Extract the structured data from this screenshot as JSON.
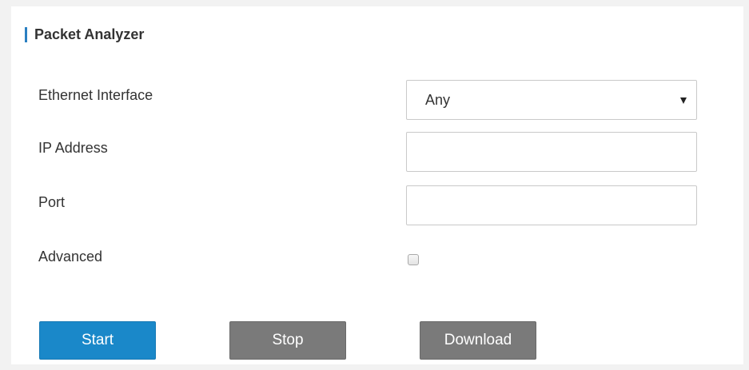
{
  "section": {
    "title": "Packet Analyzer"
  },
  "form": {
    "ethernet_interface": {
      "label": "Ethernet Interface",
      "selected": "Any"
    },
    "ip_address": {
      "label": "IP Address",
      "value": ""
    },
    "port": {
      "label": "Port",
      "value": ""
    },
    "advanced": {
      "label": "Advanced",
      "checked": false
    }
  },
  "buttons": {
    "start": "Start",
    "stop": "Stop",
    "download": "Download"
  },
  "colors": {
    "accent": "#1a88c9",
    "section_bar": "#2a7fc1",
    "secondary_button": "#7a7a7a"
  }
}
